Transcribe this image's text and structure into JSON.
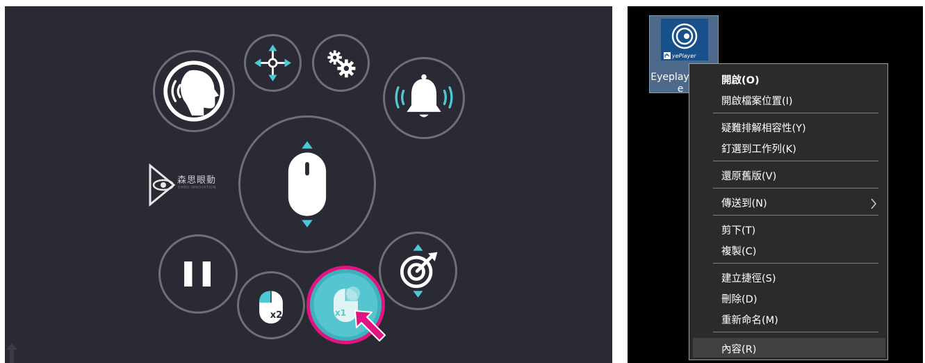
{
  "overlay": {
    "logo_text": "森思眼動",
    "logo_subtext": "EMBO INNOVATION",
    "double_click_label": "x2",
    "single_click_label": "x1",
    "colors": {
      "background": "#292a33",
      "ring": "#6f7075",
      "accent_cyan": "#4dc8d4",
      "active_fill": "#55c6cf",
      "highlight_ring": "#e0157f",
      "pointer_arrow": "#e0157f"
    },
    "buttons": [
      {
        "name": "speak-button",
        "icon": "speaking-head-icon"
      },
      {
        "name": "move-button",
        "icon": "move-arrows-icon"
      },
      {
        "name": "settings-button",
        "icon": "gears-icon"
      },
      {
        "name": "alert-button",
        "icon": "bell-ringing-icon"
      },
      {
        "name": "scroll-button",
        "icon": "mouse-scroll-icon"
      },
      {
        "name": "pause-button",
        "icon": "pause-icon"
      },
      {
        "name": "double-click-button",
        "icon": "mouse-double-click-icon"
      },
      {
        "name": "single-click-button",
        "icon": "mouse-single-click-icon",
        "state": "active"
      },
      {
        "name": "target-button",
        "icon": "target-dart-icon"
      }
    ]
  },
  "desktop": {
    "icon_badge_text": "yePlayer",
    "icon_label_line1": "Eyeplay",
    "icon_label_line2": "e"
  },
  "context_menu": {
    "items": [
      {
        "label": "開啟(O)",
        "bold": true
      },
      {
        "label": "開啟檔案位置(I)"
      },
      {
        "label": "疑難排解相容性(Y)"
      },
      {
        "label": "釘選到工作列(K)"
      },
      {
        "label": "還原舊版(V)"
      },
      {
        "label": "傳送到(N)",
        "submenu": true
      },
      {
        "label": "剪下(T)"
      },
      {
        "label": "複製(C)"
      },
      {
        "label": "建立捷徑(S)"
      },
      {
        "label": "刪除(D)"
      },
      {
        "label": "重新命名(M)"
      },
      {
        "label": "內容(R)",
        "highlighted": true
      }
    ],
    "submenu_arrow": "chevron-right-icon"
  }
}
